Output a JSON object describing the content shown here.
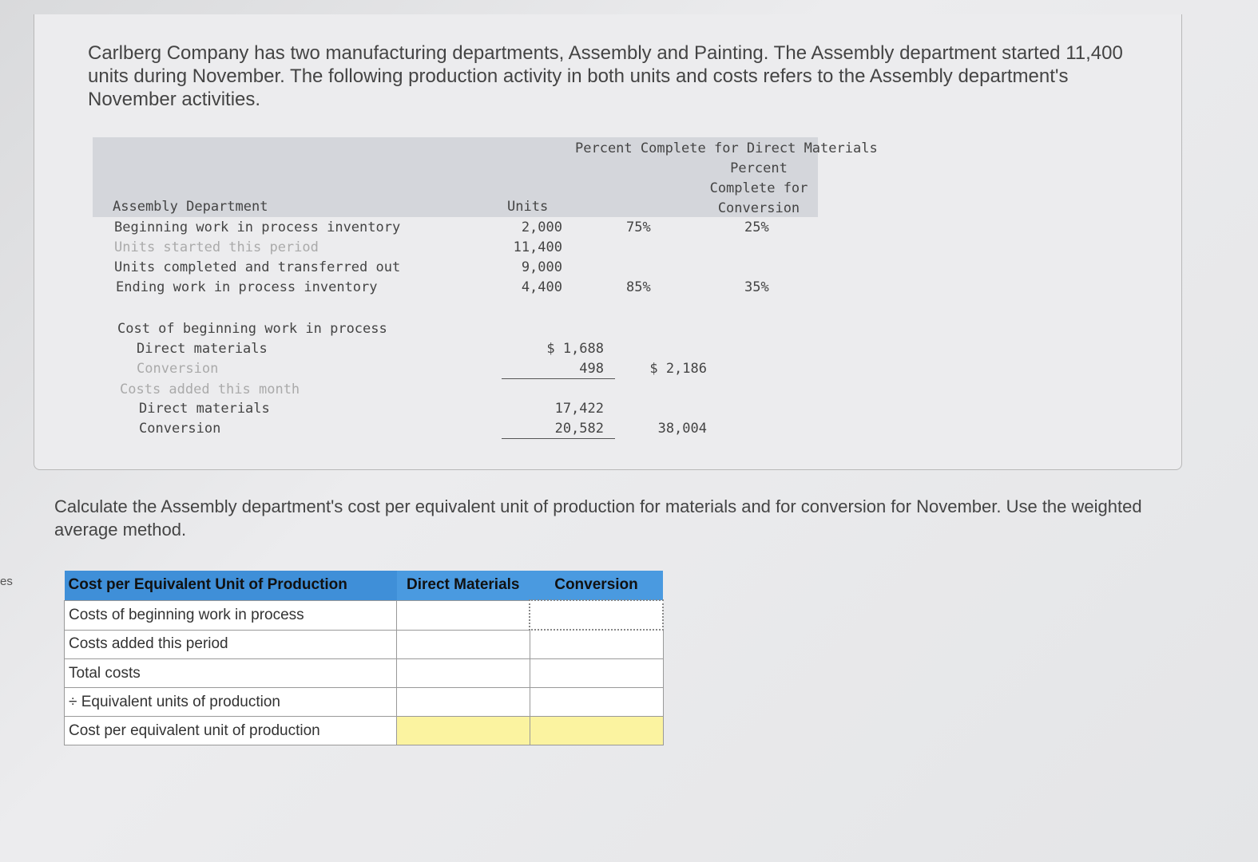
{
  "intro": "Carlberg Company has two manufacturing departments, Assembly and Painting. The Assembly department started 11,400 units during November. The following production activity in both units and costs refers to the Assembly department's November activities.",
  "units_table": {
    "dept": "Assembly Department",
    "headers": {
      "units": "Units",
      "dm": "Percent Complete for Direct Materials",
      "conv": "Percent Complete for Conversion"
    },
    "rows": [
      {
        "label": "Beginning work in process inventory",
        "units": "2,000",
        "dm": "75%",
        "conv": "25%"
      },
      {
        "label": "Units started this period",
        "units": "11,400",
        "dm": "",
        "conv": ""
      },
      {
        "label": "Units completed and transferred out",
        "units": "9,000",
        "dm": "",
        "conv": ""
      },
      {
        "label": "Ending work in process inventory",
        "units": "4,400",
        "dm": "85%",
        "conv": "35%"
      }
    ]
  },
  "cost_table": {
    "beg_title": "Cost of beginning work in process",
    "beg_dm_label": "Direct materials",
    "beg_dm": "$ 1,688",
    "beg_conv_label": "Conversion",
    "beg_conv": "498",
    "beg_total": "$ 2,186",
    "added_title": "Costs added this month",
    "add_dm_label": "Direct materials",
    "add_dm": "17,422",
    "add_conv_label": "Conversion",
    "add_conv": "20,582",
    "add_total": "38,004"
  },
  "question": "Calculate the Assembly department's cost per equivalent unit of production for materials and for conversion for November. Use the weighted average method.",
  "answer": {
    "header": "Cost per Equivalent Unit of Production",
    "col_dm": "Direct Materials",
    "col_conv": "Conversion",
    "rows": [
      "Costs of beginning work in process",
      "Costs added this period",
      "Total costs",
      "÷ Equivalent units of production",
      "Cost per equivalent unit of production"
    ]
  },
  "side_text": "es"
}
